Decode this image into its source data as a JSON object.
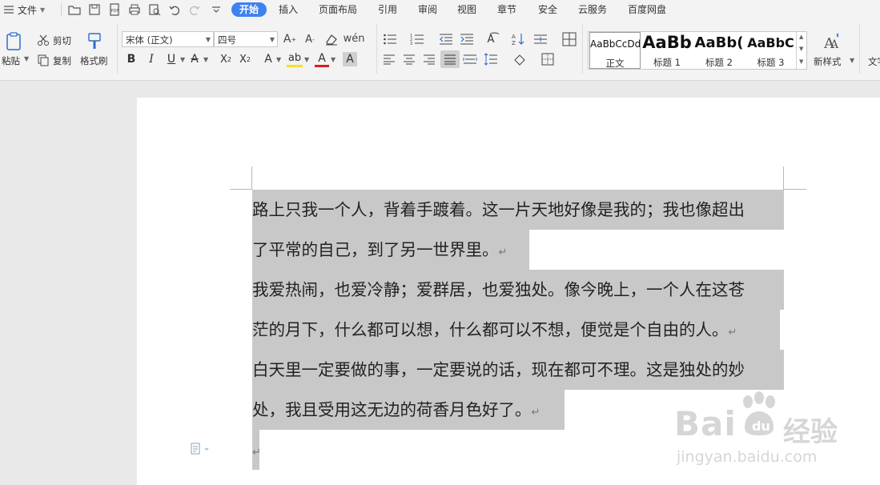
{
  "menu": {
    "file_label": "文件",
    "tabs": [
      "开始",
      "插入",
      "页面布局",
      "引用",
      "审阅",
      "视图",
      "章节",
      "安全",
      "云服务",
      "百度网盘"
    ],
    "active_tab": "开始"
  },
  "ribbon": {
    "paste_label": "粘贴",
    "cut_label": "剪切",
    "copy_label": "复制",
    "format_painter_label": "格式刷",
    "font_name": "宋体 (正文)",
    "font_size": "四号",
    "styles": [
      {
        "preview": "AaBbCcDd",
        "name": "正文"
      },
      {
        "preview": "AaBb",
        "name": "标题 1"
      },
      {
        "preview": "AaBb(",
        "name": "标题 2"
      },
      {
        "preview": "AaBbC",
        "name": "标题 3"
      }
    ],
    "new_style_label": "新样式",
    "text_tools_label": "文字"
  },
  "document": {
    "lines": [
      "路上只我一个人，背着手踱着。这一片天地好像是我的；我也像超出",
      "了平常的自己，到了另一世界里。",
      "我爱热闹，也爱冷静；爱群居，也爱独处。像今晚上，一个人在这苍",
      "茫的月下，什么都可以想，什么都可以不想，便觉是个自由的人。",
      "白天里一定要做的事，一定要说的话，现在都可不理。这是独处的妙",
      "处，我且受用这无边的荷香月色好了。",
      ""
    ],
    "paragraph_mark": "↵"
  },
  "watermark": {
    "brand": "Bai",
    "brand_tail": "经验",
    "url": "jingyan.baidu.com"
  }
}
